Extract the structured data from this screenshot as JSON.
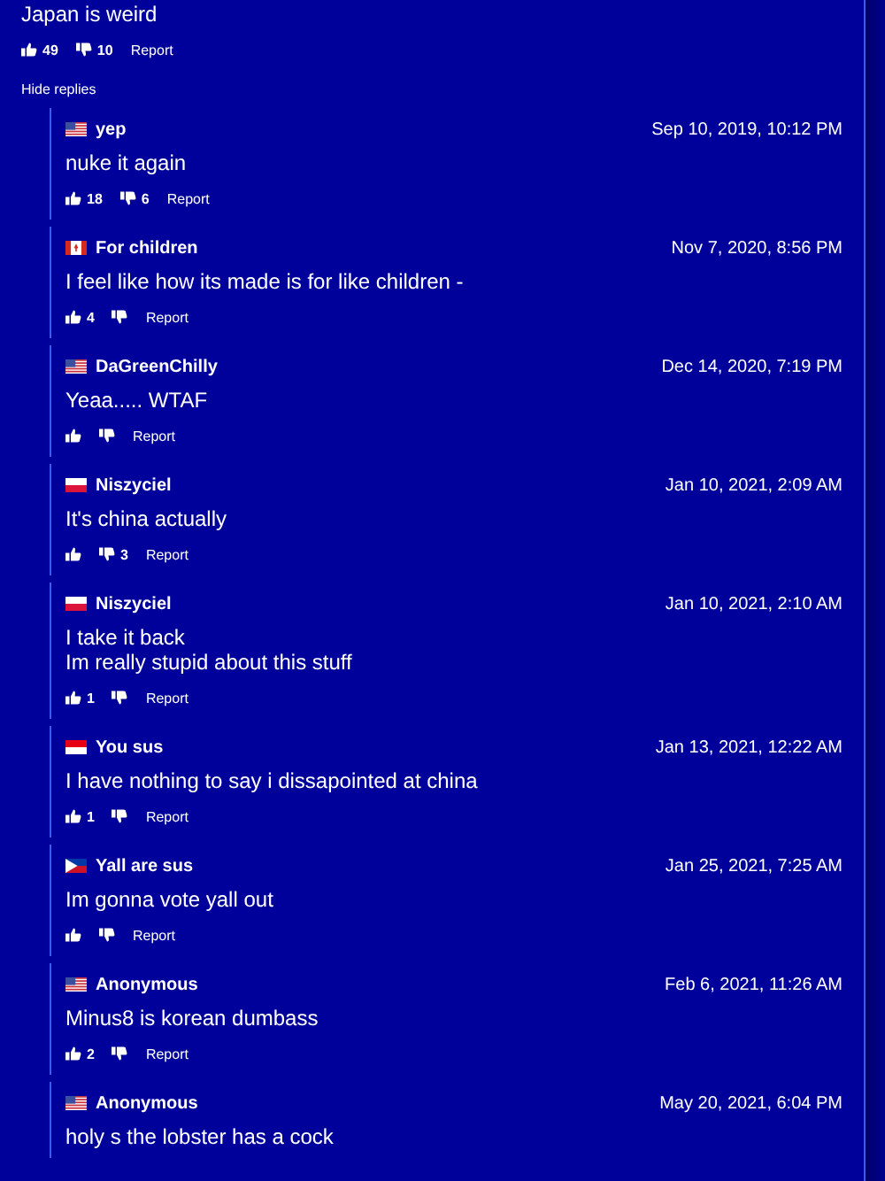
{
  "comment": {
    "text": "Japan is weird",
    "likes": "49",
    "dislikes": "10",
    "report": "Report"
  },
  "hide_replies": "Hide replies",
  "replies": [
    {
      "flag": {
        "kind": "us"
      },
      "name": "yep",
      "date": "Sep 10, 2019, 10:12 PM",
      "lines": [
        "nuke it again"
      ],
      "likes": "18",
      "dislikes": "6",
      "report": "Report"
    },
    {
      "flag": {
        "kind": "ca"
      },
      "name": "For children",
      "date": "Nov 7, 2020, 8:56 PM",
      "lines": [
        "I feel like how its made is for like children -"
      ],
      "likes": "4",
      "report": "Report"
    },
    {
      "flag": {
        "kind": "us"
      },
      "name": "DaGreenChilly",
      "date": "Dec 14, 2020, 7:19 PM",
      "lines": [
        "Yeaa..... WTAF"
      ],
      "report": "Report"
    },
    {
      "flag": {
        "kind": "pl"
      },
      "name": "Niszyciel",
      "date": "Jan 10, 2021, 2:09 AM",
      "lines": [
        "It's china actually"
      ],
      "dislikes": "3",
      "report": "Report"
    },
    {
      "flag": {
        "kind": "pl"
      },
      "name": "Niszyciel",
      "date": "Jan 10, 2021, 2:10 AM",
      "lines": [
        "I take it back",
        "Im really stupid about this stuff"
      ],
      "likes": "1",
      "report": "Report"
    },
    {
      "flag": {
        "kind": "id"
      },
      "name": "You sus",
      "date": "Jan 13, 2021, 12:22 AM",
      "lines": [
        "I have nothing to say i dissapointed at china"
      ],
      "likes": "1",
      "report": "Report"
    },
    {
      "flag": {
        "kind": "ph"
      },
      "name": "Yall are sus",
      "date": "Jan 25, 2021, 7:25 AM",
      "lines": [
        "Im gonna vote yall out"
      ],
      "report": "Report"
    },
    {
      "flag": {
        "kind": "us"
      },
      "name": "Anonymous",
      "date": "Feb 6, 2021, 11:26 AM",
      "lines": [
        "Minus8 is korean dumbass"
      ],
      "likes": "2",
      "report": "Report"
    },
    {
      "flag": {
        "kind": "us"
      },
      "name": "Anonymous",
      "date": "May 20, 2021, 6:04 PM",
      "lines": [
        "holy s the lobster has a cock"
      ]
    }
  ]
}
